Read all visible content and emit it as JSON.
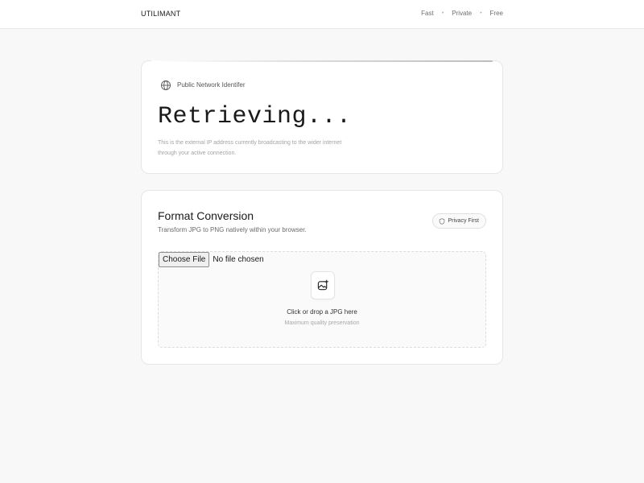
{
  "header": {
    "brand": "UTILIMANT",
    "nav": [
      "Fast",
      "Private",
      "Free"
    ]
  },
  "ip_card": {
    "label": "Public Network Identifer",
    "value": "Retrieving...",
    "description": "This is the external IP address currently broadcasting to the wider internet through your active connection."
  },
  "conversion": {
    "title": "Format Conversion",
    "subtitle": "Transform JPG to PNG natively within your browser.",
    "badge": "Privacy First",
    "file_button": "Choose File",
    "file_status": "No file chosen",
    "drop_primary": "Click or drop a JPG here",
    "drop_secondary": "Maximum quality preservation"
  },
  "icons": {
    "ip": "globe-icon",
    "badge": "shield-icon",
    "upload": "image-plus-icon"
  },
  "colors": {
    "background": "#f8f8f8",
    "card": "#ffffff",
    "text": "#1a1a1a",
    "muted": "#a3a3a3"
  }
}
